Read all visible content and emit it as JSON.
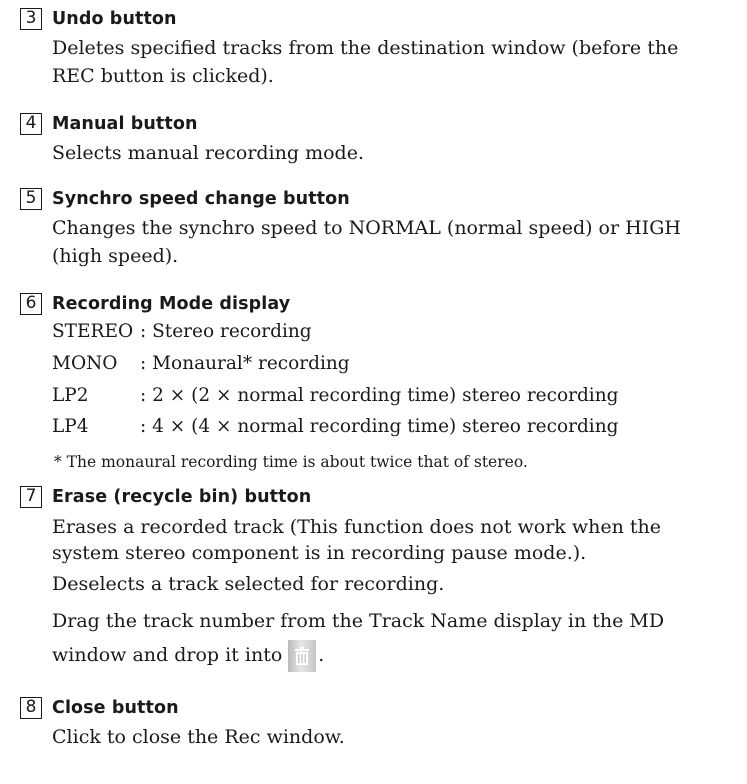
{
  "sections": [
    {
      "number": "3",
      "title": "Undo button",
      "lines": [
        "Deletes specified tracks from the destination window (before the",
        "REC button is clicked)."
      ]
    },
    {
      "number": "4",
      "title": "Manual button",
      "lines": [
        "Selects manual recording mode."
      ]
    },
    {
      "number": "5",
      "title": "Synchro speed change button",
      "lines": [
        "Changes the synchro speed to NORMAL (normal speed) or HIGH",
        "(high speed)."
      ]
    },
    {
      "number": "6",
      "title": "Recording Mode display",
      "modes": [
        {
          "term": "STEREO",
          "desc": ": Stereo recording"
        },
        {
          "term": "MONO",
          "desc": ": Monaural* recording"
        },
        {
          "term": "LP2",
          "desc": ": 2 × (2 × normal recording time) stereo recording"
        },
        {
          "term": "LP4",
          "desc": ": 4 × (4 × normal recording time) stereo recording"
        }
      ],
      "footnote": "*  The monaural recording time is about twice that of stereo."
    },
    {
      "number": "7",
      "title": "Erase (recycle bin) button",
      "lines": [
        "Erases a recorded track (This function does not work when the",
        "system stereo component is in recording pause mode.).",
        "Deselects a track selected for recording.",
        "Drag the track number from the Track Name display in the MD"
      ],
      "drag_text_before": "window and drop it into",
      "drag_text_after": ".",
      "icon": "recycle-bin-icon"
    },
    {
      "number": "8",
      "title": "Close button",
      "lines": [
        "Click to close the Rec window."
      ]
    }
  ]
}
